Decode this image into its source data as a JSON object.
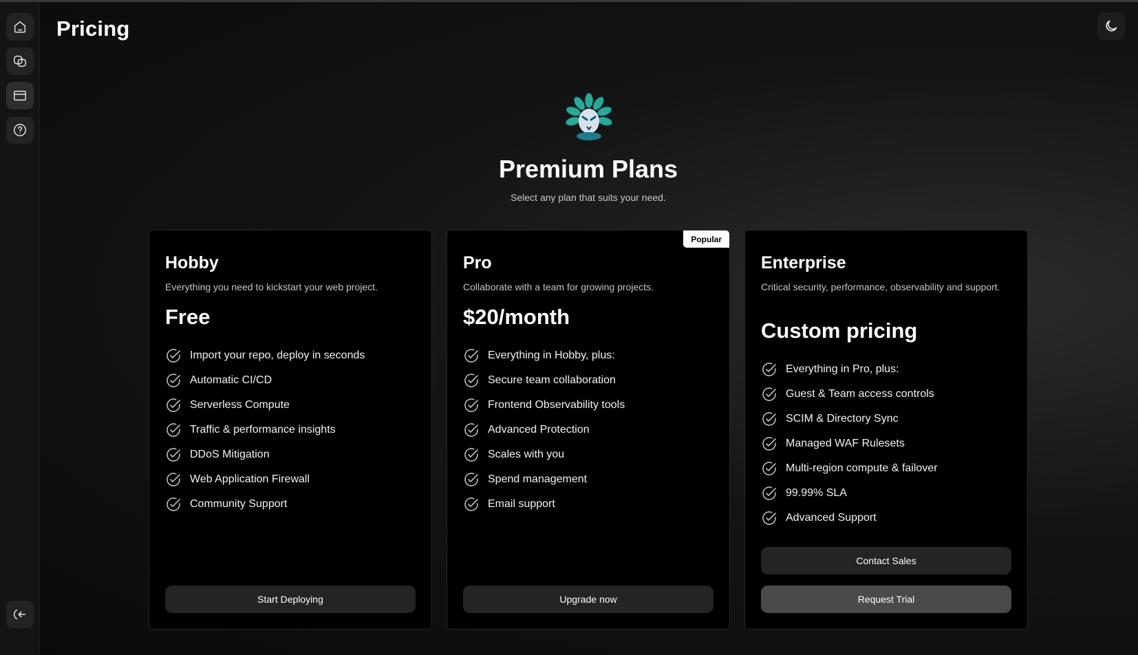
{
  "header": {
    "title": "Pricing"
  },
  "sidebar": {
    "items": [
      {
        "icon": "home-icon"
      },
      {
        "icon": "chat-bubbles-icon"
      },
      {
        "icon": "credit-card-icon"
      },
      {
        "icon": "help-circle-icon"
      }
    ],
    "bottom_icon": "logout-icon"
  },
  "theme_toggle": {
    "icon": "moon-icon"
  },
  "hero": {
    "title": "Premium Plans",
    "subtitle": "Select any plan that suits your need."
  },
  "plans": [
    {
      "name": "Hobby",
      "description": "Everything you need to kickstart your web project.",
      "price": "Free",
      "features": [
        "Import your repo, deploy in seconds",
        "Automatic CI/CD",
        "Serverless Compute",
        "Traffic & performance insights",
        "DDoS Mitigation",
        "Web Application Firewall",
        "Community Support"
      ],
      "button": "Start Deploying"
    },
    {
      "name": "Pro",
      "badge": "Popular",
      "description": "Collaborate with a team for growing projects.",
      "price": "$20/month",
      "features": [
        "Everything in Hobby, plus:",
        "Secure team collaboration",
        "Frontend Observability tools",
        "Advanced Protection",
        "Scales with you",
        "Spend management",
        "Email support"
      ],
      "button": "Upgrade now"
    },
    {
      "name": "Enterprise",
      "description": "Critical security, performance, observability and support.",
      "price": "Custom pricing",
      "features": [
        "Everything in Pro, plus:",
        "Guest & Team access controls",
        "SCIM & Directory Sync",
        "Managed WAF Rulesets",
        "Multi-region compute & failover",
        "99.99% SLA",
        "Advanced Support"
      ],
      "secondary_button": "Contact Sales",
      "button": "Request Trial"
    }
  ]
}
